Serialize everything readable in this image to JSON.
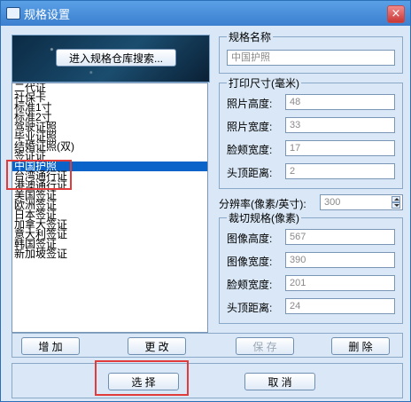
{
  "window": {
    "title": "规格设置",
    "close_label": "×"
  },
  "repo_button_label": "进入规格仓库搜索...",
  "list": {
    "items": [
      "二代证",
      "社保卡",
      "标准1寸",
      "标准2寸",
      "驾驶证照",
      "毕业证照",
      "结婚证照(双)",
      "签证证",
      "中国护照",
      "台湾通行证",
      "港澳通行证",
      "美国签证",
      "欧洲签证",
      "日本签证",
      "加拿大签证",
      "意大利签证",
      "韩国签证",
      "新加坡签证"
    ],
    "selected_index": 8
  },
  "spec_name": {
    "title": "规格名称",
    "value": "中国护照"
  },
  "print_size": {
    "title": "打印尺寸(毫米)",
    "fields": [
      {
        "label": "照片高度:",
        "value": "48"
      },
      {
        "label": "照片宽度:",
        "value": "33"
      },
      {
        "label": "脸颊宽度:",
        "value": "17"
      },
      {
        "label": "头顶距离:",
        "value": "2"
      }
    ]
  },
  "resolution": {
    "label": "分辨率(像素/英寸):",
    "value": "300"
  },
  "crop_spec": {
    "title": "裁切规格(像素)",
    "fields": [
      {
        "label": "图像高度:",
        "value": "567"
      },
      {
        "label": "图像宽度:",
        "value": "390"
      },
      {
        "label": "脸颊宽度:",
        "value": "201"
      },
      {
        "label": "头顶距离:",
        "value": "24"
      }
    ]
  },
  "actions": {
    "add": "增 加",
    "change": "更 改",
    "save": "保 存",
    "delete": "删 除"
  },
  "bottom": {
    "select": "选 择",
    "cancel": "取 消"
  },
  "colors": {
    "highlight_border": "#e23b3b",
    "selected_row": "#0a63c9"
  }
}
